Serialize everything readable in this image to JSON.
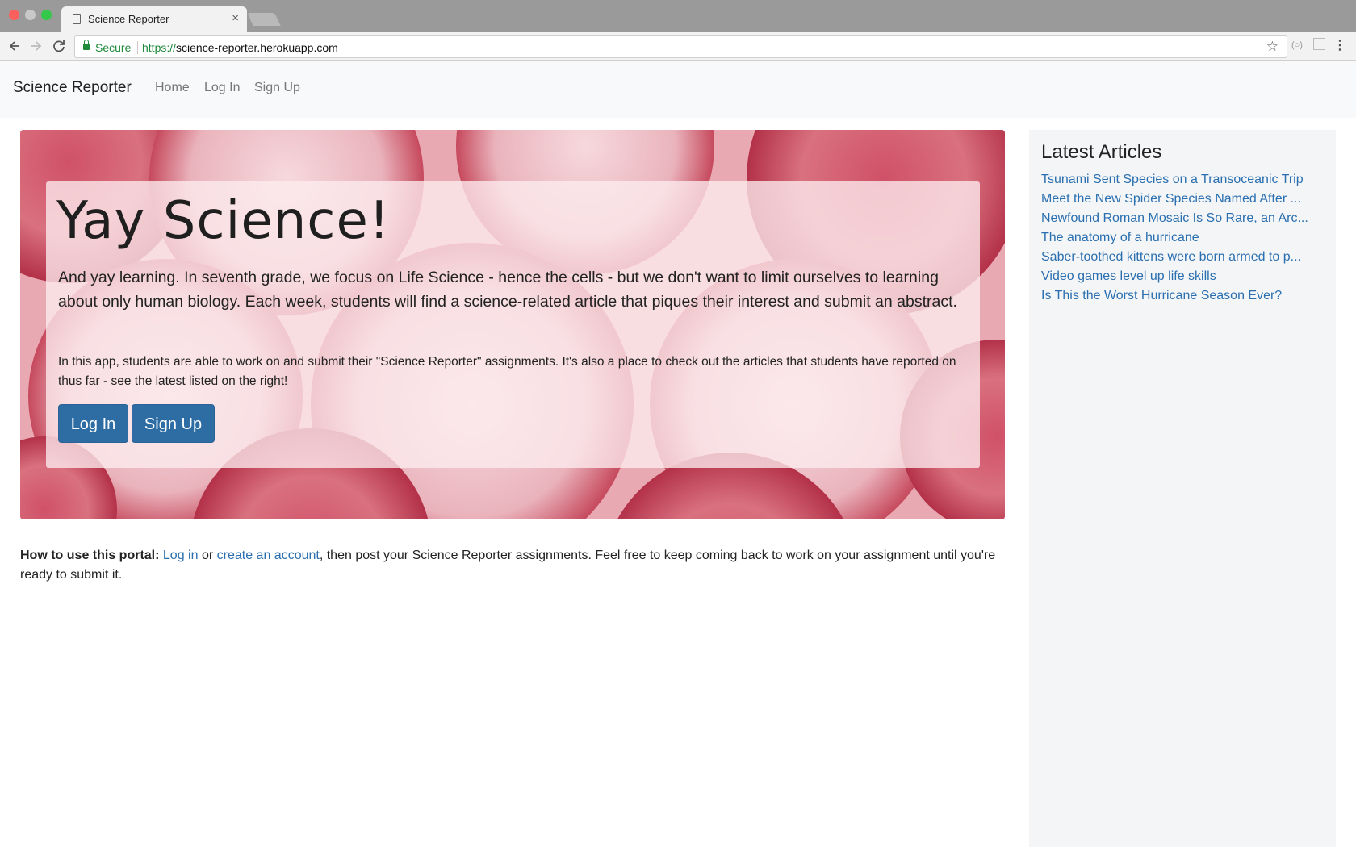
{
  "browser": {
    "tab_title": "Science Reporter",
    "tab_close": "×",
    "secure_label": "Secure",
    "url_protocol": "https://",
    "url_host": "science-reporter.herokuapp.com"
  },
  "icons": {
    "back": "back-arrow-icon",
    "forward": "forward-arrow-icon",
    "reload": "reload-icon",
    "bookmark": "star-icon",
    "menu": "more-vert-icon"
  },
  "navbar": {
    "brand": "Science Reporter",
    "links": [
      "Home",
      "Log In",
      "Sign Up"
    ]
  },
  "hero": {
    "title": "Yay Science!",
    "lead": "And yay learning. In seventh grade, we focus on Life Science - hence the cells - but we don't want to limit ourselves to learning about only human biology. Each week, students will find a science-related article that piques their interest and submit an abstract.",
    "body": "In this app, students are able to work on and submit their \"Science Reporter\" assignments. It's also a place to check out the articles that students have reported on thus far - see the latest listed on the right!",
    "login_button": "Log In",
    "signup_button": "Sign Up"
  },
  "howto": {
    "label": "How to use this portal:",
    "login_link": "Log in",
    "or": "or",
    "create_link": "create an account",
    "rest": ", then post your Science Reporter assignments. Feel free to keep coming back to work on your assignment until you're ready to submit it."
  },
  "sidebar": {
    "heading": "Latest Articles",
    "articles": [
      "Tsunami Sent Species on a Transoceanic Trip",
      "Meet the New Spider Species Named After ...",
      "Newfound Roman Mosaic Is So Rare, an Arc...",
      "The anatomy of a hurricane",
      "Saber-toothed kittens were born armed to p...",
      "Video games level up life skills",
      "Is This the Worst Hurricane Season Ever?"
    ]
  },
  "colors": {
    "link": "#2a6fb0",
    "primary_button": "#2e6da4",
    "secure_green": "#1e8a3a"
  }
}
